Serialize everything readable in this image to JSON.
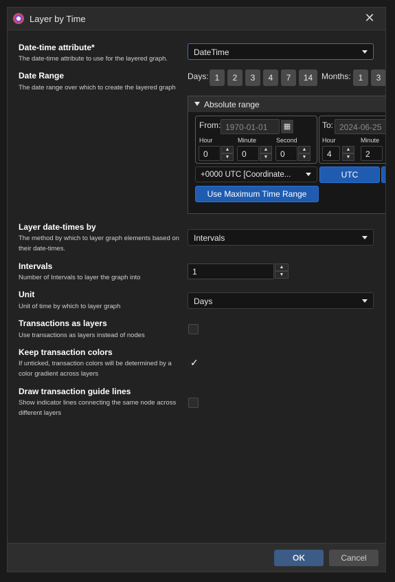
{
  "window": {
    "title": "Layer by Time",
    "close_icon": "close-icon"
  },
  "datetime_attribute": {
    "label": "Date-time attribute*",
    "description": "The date-time attribute to use for the layered graph.",
    "value": "DateTime"
  },
  "date_range": {
    "label": "Date Range",
    "description": "The date range over which to create the layered graph",
    "days_label": "Days:",
    "days": [
      "1",
      "2",
      "3",
      "4",
      "7",
      "14"
    ],
    "months_label": "Months:",
    "months": [
      "1",
      "3"
    ],
    "panel_title": "Absolute range",
    "from_label": "From:",
    "from_date": "1970-01-01",
    "to_label": "To:",
    "to_date": "2024-06-25",
    "hour_label": "Hour",
    "minute_label": "Minute",
    "second_label": "Second",
    "from_hour": "0",
    "from_minute": "0",
    "from_second": "0",
    "to_hour": "4",
    "to_minute": "2",
    "timezone": "+0000 UTC [Coordinate...",
    "utc_button": "UTC",
    "max_range_button": "Use Maximum Time Range"
  },
  "layer_by": {
    "label": "Layer date-times by",
    "description": "The method by which to layer graph elements based on their date-times.",
    "value": "Intervals"
  },
  "intervals": {
    "label": "Intervals",
    "description": "Number of Intervals to layer the graph into",
    "value": "1"
  },
  "unit": {
    "label": "Unit",
    "description": "Unit of time by which to layer graph",
    "value": "Days"
  },
  "transactions_as_layers": {
    "label": "Transactions as layers",
    "description": "Use transactions as layers instead of nodes",
    "checked": false
  },
  "keep_colors": {
    "label": "Keep transaction colors",
    "description_line1": "If unticked, transaction colors will be determined by a",
    "description_line2": "color gradient across layers",
    "checked": true,
    "checkmark": "✓"
  },
  "guide_lines": {
    "label": "Draw transaction guide lines",
    "description_line1": "Show indicator lines connecting the same node across",
    "description_line2": "different layers",
    "checked": false
  },
  "footer": {
    "ok": "OK",
    "cancel": "Cancel"
  }
}
